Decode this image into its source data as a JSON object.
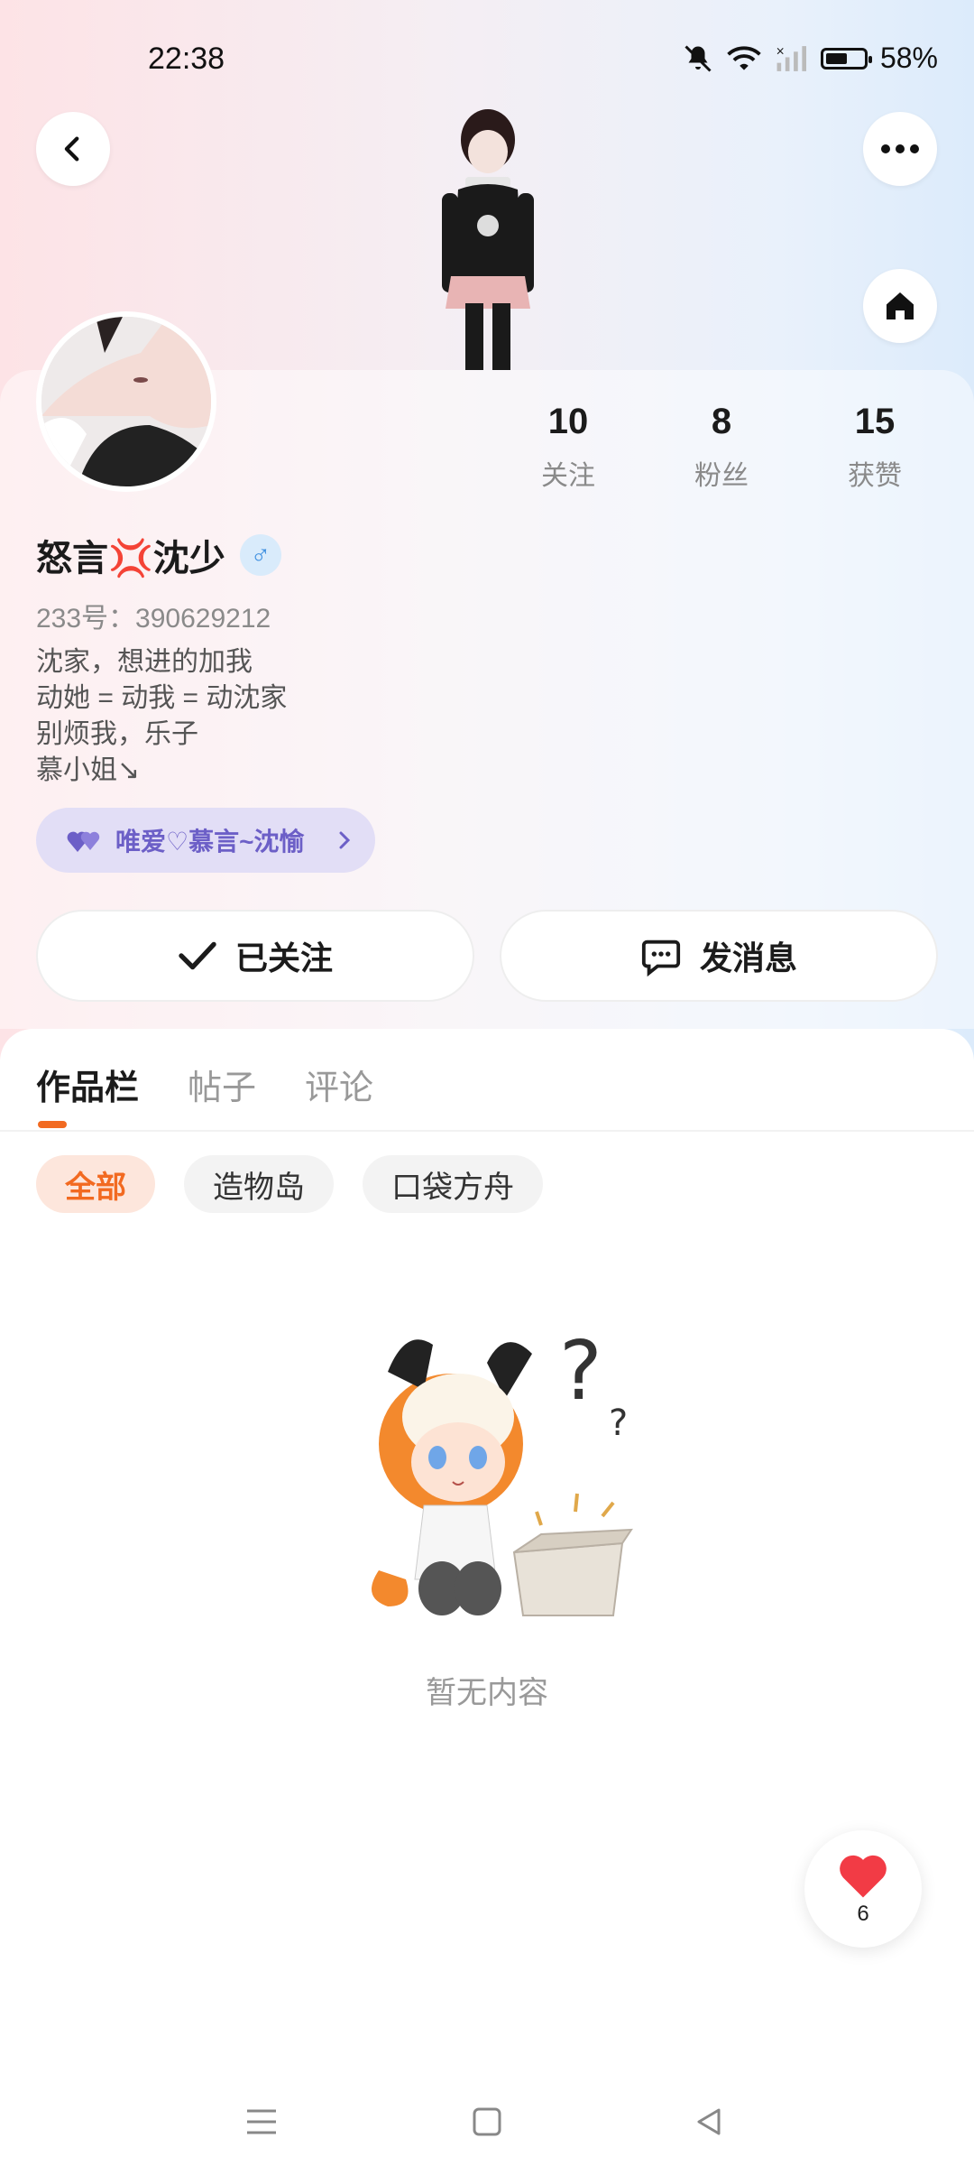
{
  "status_bar": {
    "time": "22:38",
    "battery": "58%",
    "battery_level": 0.58,
    "icons": [
      "bell-mute-icon",
      "wifi-icon",
      "signal-icon",
      "battery-icon"
    ]
  },
  "header": {
    "back_icon": "back-arrow-icon",
    "more_icon": "more-dots-icon",
    "home_icon": "home-icon"
  },
  "profile": {
    "name": "怒言💢沈少",
    "gender_symbol": "♂",
    "uid": "233号：390629212",
    "bio": [
      "沈家，想进的加我",
      "动她 = 动我 = 动沈家",
      "别烦我，乐子",
      "慕小姐↘"
    ],
    "couple_tag": "唯爱♡慕言~沈愉",
    "colors": {
      "couple_bg": "#e2def6",
      "couple_text": "#6c5fc7",
      "gender": "#3f90e0"
    }
  },
  "stats": [
    {
      "num": "10",
      "label": "关注"
    },
    {
      "num": "8",
      "label": "粉丝"
    },
    {
      "num": "15",
      "label": "获赞"
    }
  ],
  "actions": {
    "follow_label": "已关注",
    "message_label": "发消息"
  },
  "tabs": [
    {
      "label": "作品栏",
      "active": true
    },
    {
      "label": "帖子",
      "active": false
    },
    {
      "label": "评论",
      "active": false
    }
  ],
  "chips": [
    {
      "label": "全部",
      "active": true
    },
    {
      "label": "造物岛",
      "active": false
    },
    {
      "label": "口袋方舟",
      "active": false
    }
  ],
  "empty_state": {
    "text": "暂无内容"
  },
  "like_fab": {
    "count": "6"
  },
  "accent_color": "#f26a21",
  "nav_bar": [
    "menu-icon",
    "home-square-icon",
    "back-triangle-icon"
  ]
}
